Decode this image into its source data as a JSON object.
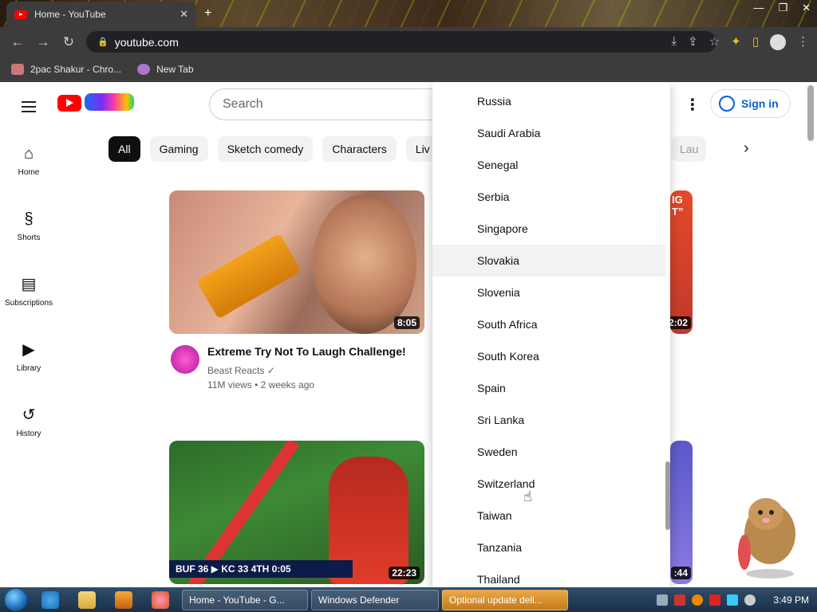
{
  "browser": {
    "tab_title": "Home - YouTube",
    "tab_close": "✕",
    "new_tab": "+",
    "url": "youtube.com",
    "bookmarks": [
      {
        "label": "2pac Shakur - Chro..."
      },
      {
        "label": "New Tab"
      }
    ]
  },
  "youtube": {
    "search_placeholder": "Search",
    "signin_label": "Sign in",
    "more_icon": "⋮",
    "guide": [
      {
        "icon": "⌂",
        "label": "Home"
      },
      {
        "icon": "§",
        "label": "Shorts"
      },
      {
        "icon": "▤",
        "label": "Subscriptions"
      },
      {
        "icon": "▶",
        "label": "Library"
      },
      {
        "icon": "↺",
        "label": "History"
      }
    ],
    "chips": [
      "All",
      "Gaming",
      "Sketch comedy",
      "Characters",
      "Liv"
    ],
    "chip_right": "Lau",
    "videos": [
      {
        "title": "Extreme Try Not To Laugh Challenge!",
        "channel": "Beast Reacts ✓",
        "stats": "11M views • 2 weeks ago",
        "duration": "8:05"
      },
      {
        "duration": "22:23",
        "score": "BUF 36  ▶  KC 33   4TH  0:05"
      }
    ],
    "right_durations": [
      "2:02",
      ":44"
    ],
    "right_caption": "IG T”"
  },
  "dropdown": {
    "options": [
      "Russia",
      "Saudi Arabia",
      "Senegal",
      "Serbia",
      "Singapore",
      "Slovakia",
      "Slovenia",
      "South Africa",
      "South Korea",
      "Spain",
      "Sri Lanka",
      "Sweden",
      "Switzerland",
      "Taiwan",
      "Tanzania",
      "Thailand"
    ],
    "highlighted": "Slovakia"
  },
  "taskbar": {
    "buttons": [
      "Home - YouTube - G...",
      "Windows Defender",
      "Optional update deli..."
    ],
    "clock": "3:49 PM"
  }
}
